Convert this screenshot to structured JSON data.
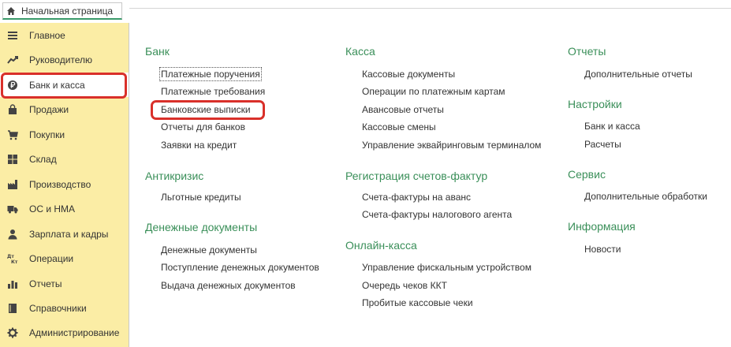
{
  "tab": {
    "label": "Начальная страница",
    "icon": "home-icon"
  },
  "sidebar": {
    "items": [
      {
        "label": "Главное",
        "icon": "menu-lines-icon"
      },
      {
        "label": "Руководителю",
        "icon": "trend-up-icon"
      },
      {
        "label": "Банк и касса",
        "icon": "ruble-coin-icon"
      },
      {
        "label": "Продажи",
        "icon": "shopping-bag-icon"
      },
      {
        "label": "Покупки",
        "icon": "shopping-cart-icon"
      },
      {
        "label": "Склад",
        "icon": "warehouse-grid-icon"
      },
      {
        "label": "Производство",
        "icon": "factory-icon"
      },
      {
        "label": "ОС и НМА",
        "icon": "truck-icon"
      },
      {
        "label": "Зарплата и кадры",
        "icon": "person-icon"
      },
      {
        "label": "Операции",
        "icon": "operations-icon"
      },
      {
        "label": "Отчеты",
        "icon": "bar-chart-icon"
      },
      {
        "label": "Справочники",
        "icon": "book-icon"
      },
      {
        "label": "Администрирование",
        "icon": "gear-icon"
      }
    ],
    "active_index": 2
  },
  "columns": [
    {
      "sections": [
        {
          "title": "Банк",
          "links": [
            "Платежные поручения",
            "Платежные требования",
            "Банковские выписки",
            "Отчеты для банков",
            "Заявки на кредит"
          ]
        },
        {
          "title": "Антикризис",
          "links": [
            "Льготные кредиты"
          ]
        },
        {
          "title": "Денежные документы",
          "links": [
            "Денежные документы",
            "Поступление денежных документов",
            "Выдача денежных документов"
          ]
        }
      ]
    },
    {
      "sections": [
        {
          "title": "Касса",
          "links": [
            "Кассовые документы",
            "Операции по платежным картам",
            "Авансовые отчеты",
            "Кассовые смены",
            "Управление эквайринговым терминалом"
          ]
        },
        {
          "title": "Регистрация счетов-фактур",
          "links": [
            "Счета-фактуры на аванс",
            "Счета-фактуры налогового агента"
          ]
        },
        {
          "title": "Онлайн-касса",
          "links": [
            "Управление фискальным устройством",
            "Очередь чеков ККТ",
            "Пробитые кассовые чеки"
          ]
        }
      ]
    },
    {
      "sections": [
        {
          "title": "Отчеты",
          "links": [
            "Дополнительные отчеты"
          ]
        },
        {
          "title": "Настройки",
          "links": [
            "Банк и касса",
            "Расчеты"
          ]
        },
        {
          "title": "Сервис",
          "links": [
            "Дополнительные обработки"
          ]
        },
        {
          "title": "Информация",
          "links": [
            "Новости"
          ]
        }
      ]
    }
  ],
  "colors": {
    "sidebar_bg": "#fbeda5",
    "section_title": "#3a8f59",
    "highlight": "#d9302a"
  }
}
